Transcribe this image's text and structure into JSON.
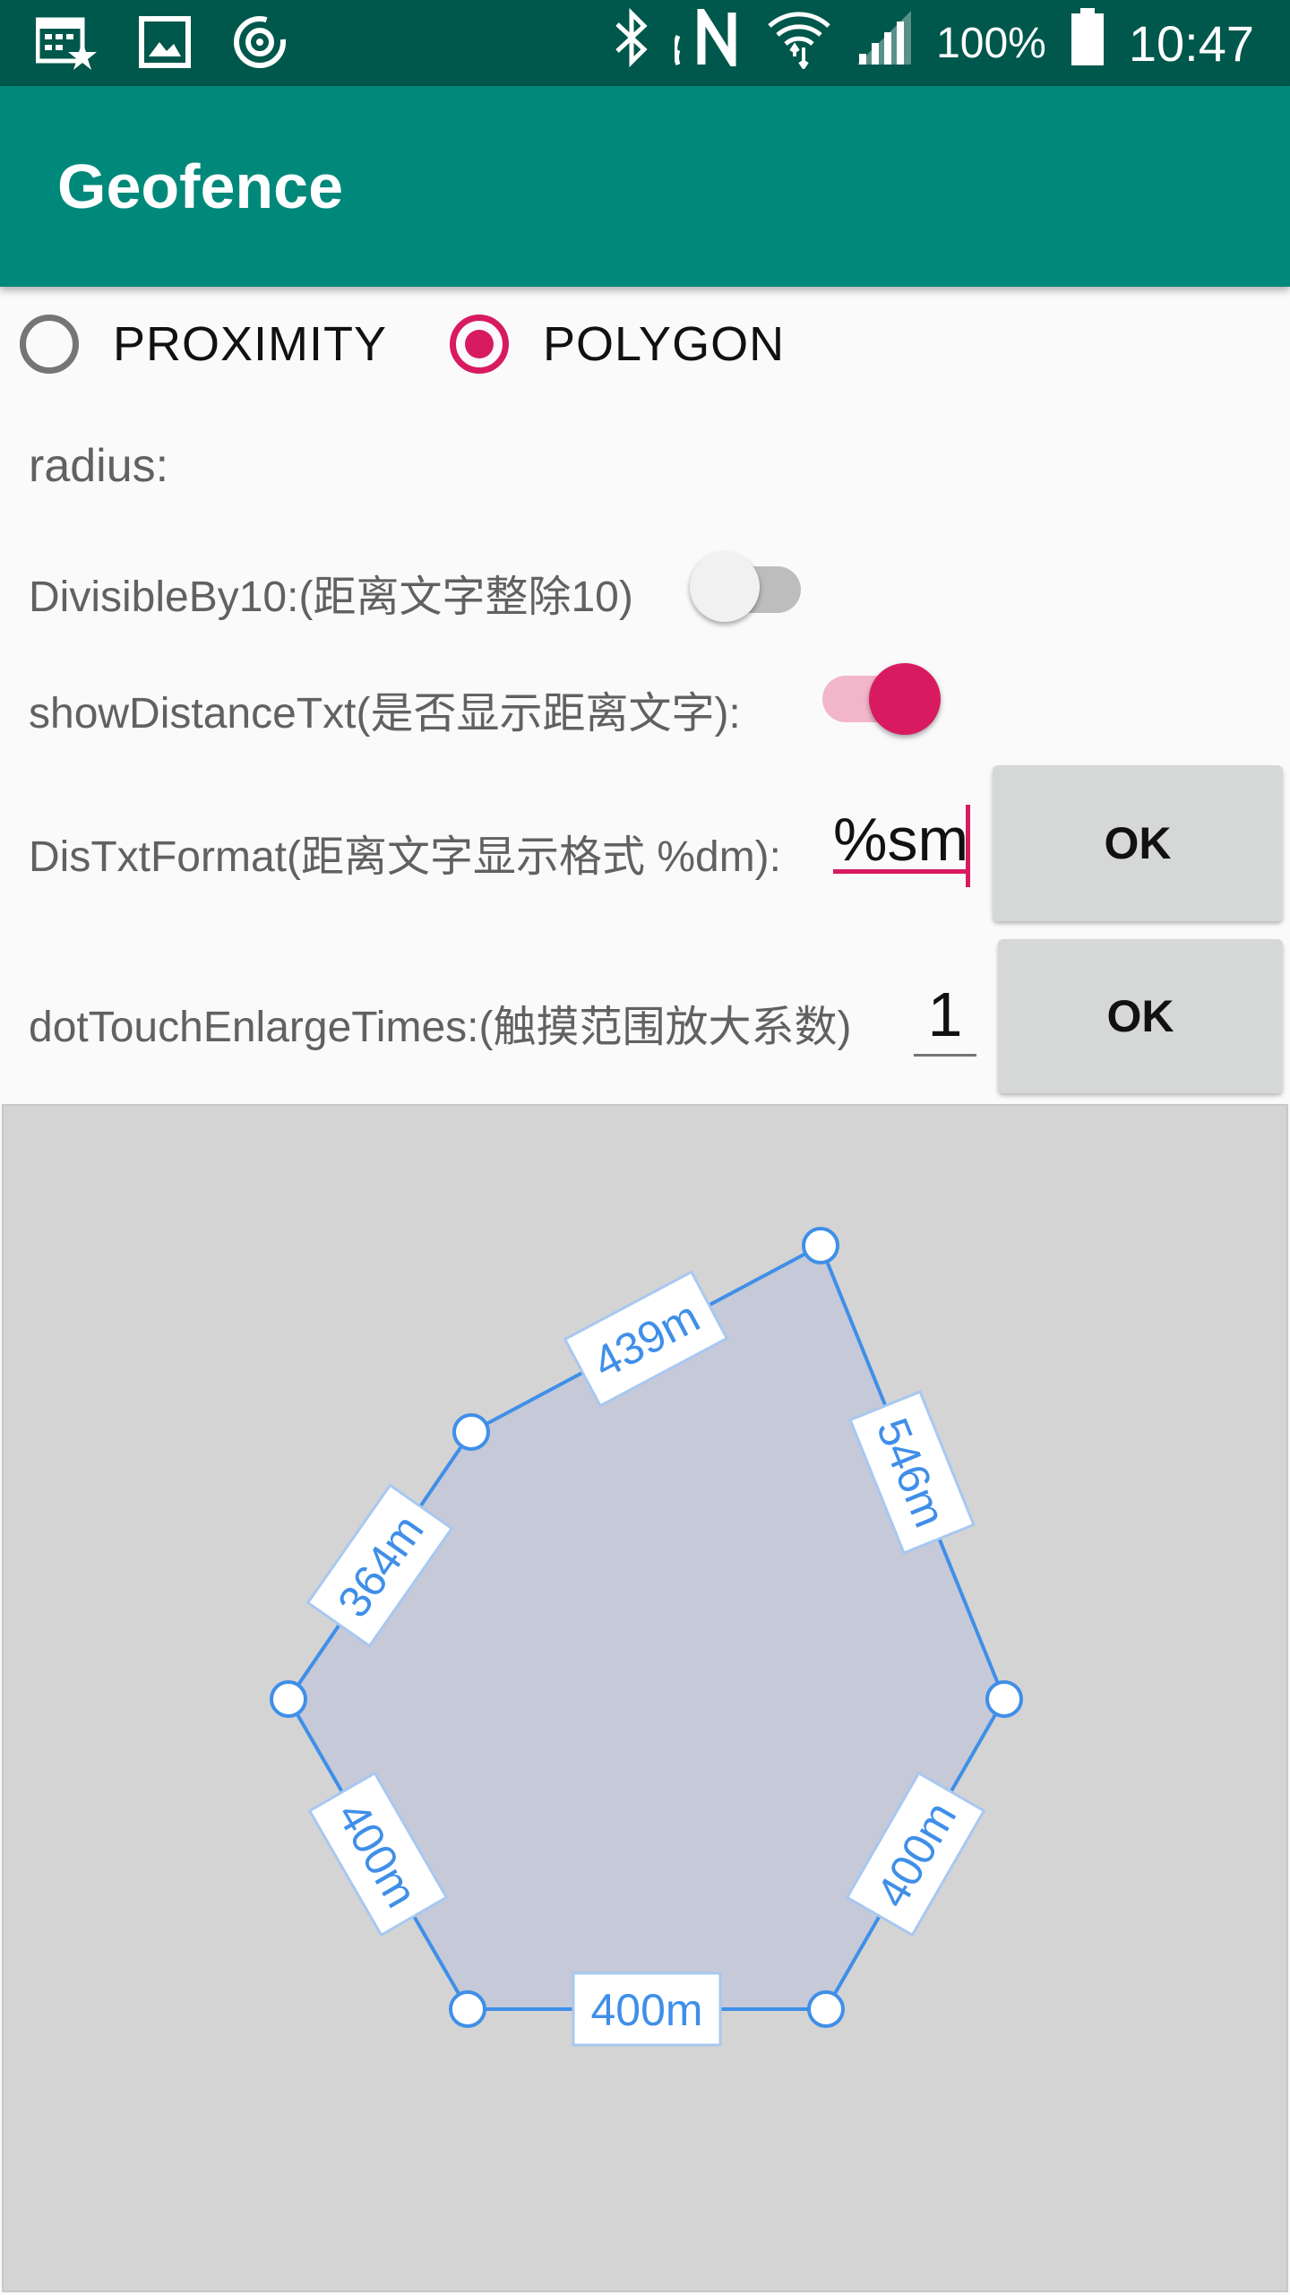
{
  "status_bar": {
    "battery": "100%",
    "time": "10:47",
    "icons": [
      "calendar-star-icon",
      "image-icon",
      "sync-icon",
      "bluetooth-icon",
      "nfc-icon",
      "wifi-icon",
      "signal-icon",
      "battery-icon"
    ]
  },
  "toolbar": {
    "title": "Geofence"
  },
  "mode": {
    "options": [
      {
        "label": "PROXIMITY",
        "selected": false
      },
      {
        "label": "POLYGON",
        "selected": true
      }
    ]
  },
  "settings": {
    "radius_label": "radius:",
    "divisible_label": "DivisibleBy10:(距离文字整除10)",
    "divisible_on": false,
    "show_distance_label": "showDistanceTxt(是否显示距离文字):",
    "show_distance_on": true,
    "format_label": "DisTxtFormat(距离文字显示格式 %dm):",
    "format_value": "%sm",
    "format_ok": "OK",
    "enlarge_label": "dotTouchEnlargeTimes:(触摸范围放大系数)",
    "enlarge_value": "1",
    "enlarge_ok": "OK"
  },
  "polygon": {
    "edge_labels": [
      "439m",
      "546m",
      "400m",
      "400m",
      "400m",
      "364m"
    ]
  },
  "colors": {
    "status_bar": "#00574b",
    "toolbar": "#00897b",
    "accent": "#d81b60",
    "polygon_stroke": "#3f8fe8",
    "polygon_fill": "#c5c9d8",
    "canvas_bg": "#d4d4d4"
  }
}
